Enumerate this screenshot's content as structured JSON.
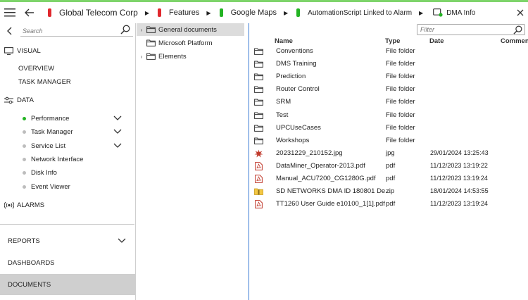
{
  "topbar": {
    "menu_icon": "hamburger-icon",
    "back_icon": "arrow-left-icon",
    "breadcrumbs": [
      {
        "label": "Global Telecom Corp",
        "color": "#e0282e"
      },
      {
        "label": "Features",
        "color": "#e0282e"
      },
      {
        "label": "Google Maps",
        "color": "#23b323"
      },
      {
        "label": "AutomationScript Linked to Alarm",
        "color": "#23b323"
      },
      {
        "label": "DMA Info",
        "color": "#23b323"
      }
    ],
    "close_icon": "close-icon"
  },
  "sidebar": {
    "search_placeholder": "Search",
    "visual": {
      "label": "VISUAL",
      "items": [
        "OVERVIEW",
        "TASK MANAGER"
      ]
    },
    "data": {
      "label": "DATA",
      "items": [
        {
          "label": "Performance",
          "active": true
        },
        {
          "label": "Task Manager",
          "active": false
        },
        {
          "label": "Service List",
          "active": false
        },
        {
          "label": "Network Interface",
          "active": false
        },
        {
          "label": "Disk Info",
          "active": false
        },
        {
          "label": "Event Viewer",
          "active": false
        }
      ]
    },
    "alarms_label": "ALARMS",
    "bottom": [
      "REPORTS",
      "DASHBOARDS",
      "DOCUMENTS"
    ]
  },
  "tree": {
    "items": [
      {
        "label": "General documents",
        "selected": true
      },
      {
        "label": "Microsoft Platform",
        "selected": false
      },
      {
        "label": "Elements",
        "selected": false
      }
    ]
  },
  "filelist": {
    "filter_placeholder": "Filter",
    "columns": [
      "Name",
      "Type",
      "Date",
      "Commen"
    ],
    "rows": [
      {
        "name": "Conventions",
        "type": "File folder",
        "date": "",
        "icon": "folder-icon"
      },
      {
        "name": "DMS Training",
        "type": "File folder",
        "date": "",
        "icon": "folder-icon"
      },
      {
        "name": "Prediction",
        "type": "File folder",
        "date": "",
        "icon": "folder-icon"
      },
      {
        "name": "Router Control",
        "type": "File folder",
        "date": "",
        "icon": "folder-icon"
      },
      {
        "name": "SRM",
        "type": "File folder",
        "date": "",
        "icon": "folder-icon"
      },
      {
        "name": "Test",
        "type": "File folder",
        "date": "",
        "icon": "folder-icon"
      },
      {
        "name": "UPCUseCases",
        "type": "File folder",
        "date": "",
        "icon": "folder-icon"
      },
      {
        "name": "Workshops",
        "type": "File folder",
        "date": "",
        "icon": "folder-icon"
      },
      {
        "name": "20231229_210152.jpg",
        "type": "jpg",
        "date": "29/01/2024 13:25:43",
        "icon": "image-icon"
      },
      {
        "name": "DataMiner_Operator-2013.pdf",
        "type": "pdf",
        "date": "11/12/2023 13:19:22",
        "icon": "pdf-icon"
      },
      {
        "name": "Manual_ACU7200_CG1280G.pdf",
        "type": "pdf",
        "date": "11/12/2023 13:19:24",
        "icon": "pdf-icon"
      },
      {
        "name": "SD NETWORKS DMA ID 180801 De...",
        "type": "zip",
        "date": "18/01/2024 14:53:55",
        "icon": "zip-icon"
      },
      {
        "name": "TT1260 User Guide e10100_1[1].pdf",
        "type": "pdf",
        "date": "11/12/2023 13:19:24",
        "icon": "pdf-icon"
      }
    ]
  }
}
